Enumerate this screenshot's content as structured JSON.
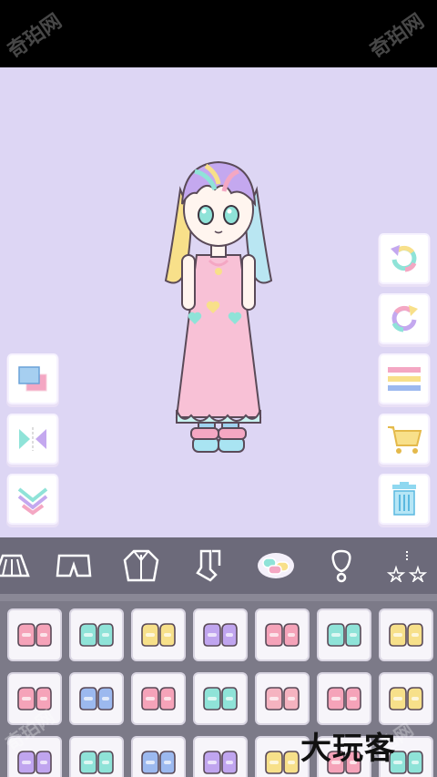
{
  "watermarks": {
    "top_left": "奇珀网",
    "top_right": "奇珀网",
    "bottom_left": "奇珀网",
    "bottom_right": "奇珀网"
  },
  "brand_text": "大玩客",
  "left_tools": [
    {
      "name": "layer-order-icon"
    },
    {
      "name": "flip-icon"
    },
    {
      "name": "move-down-icon"
    }
  ],
  "right_tools": [
    {
      "name": "undo-icon"
    },
    {
      "name": "redo-icon"
    },
    {
      "name": "menu-icon"
    },
    {
      "name": "shop-cart-icon"
    },
    {
      "name": "trash-icon"
    }
  ],
  "categories": [
    {
      "name": "skirt-icon"
    },
    {
      "name": "shorts-icon"
    },
    {
      "name": "jacket-icon"
    },
    {
      "name": "socks-icon"
    },
    {
      "name": "shoes-icon",
      "selected": true
    },
    {
      "name": "accessory-icon"
    },
    {
      "name": "sparkle-icon"
    }
  ],
  "colors": {
    "stage_bg": "#ddd6f4",
    "category_bar": "#6c6a7a",
    "grid_bg": "#7c7a88",
    "accent_pink": "#f4a7c3",
    "accent_cyan": "#8fe3d8",
    "accent_yellow": "#f8df84",
    "accent_purple": "#c4a8ef"
  },
  "shoe_items": [
    {
      "color": "#f5a3b9"
    },
    {
      "color": "#8fe3d8"
    },
    {
      "color": "#f7e08a"
    },
    {
      "color": "#c0a5ef"
    },
    {
      "color": "#f5a3b9"
    },
    {
      "color": "#8fe3d8"
    },
    {
      "color": "#f7e08a"
    },
    {
      "color": "#f5a3b9"
    },
    {
      "color": "#9cb9ef"
    },
    {
      "color": "#f5a3b9"
    },
    {
      "color": "#8fe3d8"
    },
    {
      "color": "#f5b3c0"
    },
    {
      "color": "#f5a3b9"
    },
    {
      "color": "#f7e08a"
    },
    {
      "color": "#c0a5ef"
    },
    {
      "color": "#8fe3d8"
    },
    {
      "color": "#9cb9ef"
    },
    {
      "color": "#c0a5ef"
    },
    {
      "color": "#f7e08a"
    },
    {
      "color": "#f5a3b9"
    },
    {
      "color": "#8fe3d8"
    }
  ]
}
